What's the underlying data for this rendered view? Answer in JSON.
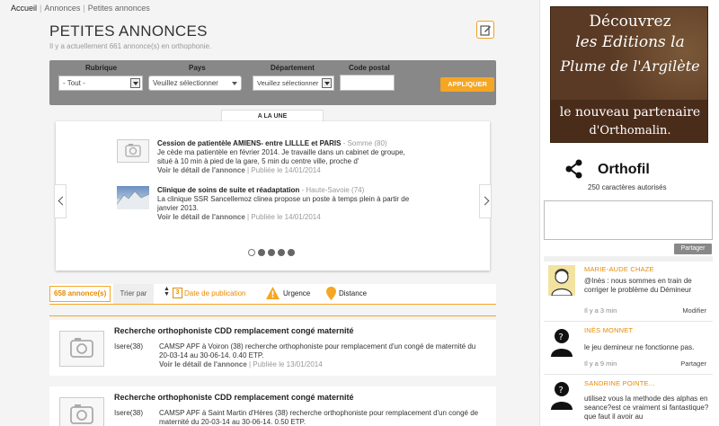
{
  "breadcrumb": {
    "home": "Accueil",
    "items": [
      "Annonces",
      "Petites annonces"
    ]
  },
  "page": {
    "title": "PETITES ANNONCES",
    "subtitle": "Il y a actuellement 661 annonce(s) en orthophonie."
  },
  "filters": {
    "rubrique_label": "Rubrique",
    "rubrique_value": "- Tout -",
    "pays_label": "Pays",
    "pays_value": "Veuillez sélectionner",
    "departement_label": "Département",
    "departement_value": "Veuillez sélectionner",
    "postal_label": "Code postal",
    "postal_value": "",
    "apply_label": "APPLIQUER"
  },
  "featured": {
    "tab_label": "A LA UNE",
    "items": [
      {
        "title": "Cession de patientèle AMIENS- entre LILLLE et PARIS",
        "location": " - Somme (80)",
        "description": "Je cède ma patientèle en février 2014. Je travaille dans un cabinet de groupe, situé à 10 min à pied de la gare, 5 min du centre ville, proche d'",
        "link": "Voir le détail de l'annonce",
        "published": " | Publiée le 14/01/2014"
      },
      {
        "title": "Clinique de soins de suite et réadaptation",
        "location": " - Haute-Savoie (74)",
        "description": "La clinique SSR Sancellemoz clinea propose un poste à temps plein à partir de janvier 2013.",
        "link": "Voir le détail de l'annonce",
        "published": " | Publiée le 14/01/2014"
      }
    ],
    "page_count": 5,
    "active_page": 1
  },
  "sort_bar": {
    "count": "658 annonce(s)",
    "sort_label": "Trier par",
    "date_label": "Date de publication",
    "calendar_digit": "3",
    "urgence_label": "Urgence",
    "distance_label": "Distance"
  },
  "listings": [
    {
      "title": "Recherche orthophoniste CDD remplacement congé maternité",
      "region": "Isere(38)",
      "description": "CAMSP APF à Voiron (38) recherche orthophoniste pour remplacement d'un congé de maternité du 20-03-14 au 30-06-14. 0.40 ETP.",
      "link": "Voir le détail de l'annonce",
      "published": " | Publiée le 13/01/2014"
    },
    {
      "title": "Recherche orthophoniste CDD remplacement congé maternité",
      "region": "Isere(38)",
      "description": "CAMSP APF à Saint Martin d'Hères (38) recherche orthophoniste pour remplacement d'un congé de maternité du 20-03-14 au 30-06-14. 0.50 ETP.",
      "link": "",
      "published": ""
    }
  ],
  "ad": {
    "line1": "Découvrez",
    "line2": "les Editions la",
    "line3": "Plume de l'Argilète",
    "line4": "le nouveau partenaire",
    "line5": "d'Orthomalin."
  },
  "social": {
    "brand": "Orthofil",
    "chars_hint": "250 caractères autorisés",
    "message_value": "",
    "share_label": "Partager"
  },
  "comments": [
    {
      "author": "Marie-aude Chaze",
      "text": "@Inès : nous sommes en train de corriger le problème du Démineur",
      "time": "Il y a 3 min",
      "action": "Modifier"
    },
    {
      "author": "Inès Monnet",
      "text": "le jeu demineur ne fonctionne pas.",
      "time": "Il y a 9 min",
      "action": "Partager"
    },
    {
      "author": "Sandrine Pointe...",
      "text": "utilisez vous la methode des alphas en seance?est ce vraiment si fantastique?que faut il avoir au",
      "time": "",
      "action": ""
    }
  ],
  "colors": {
    "accent": "#f5a623",
    "accent_text": "#e88a00",
    "filter_bar": "#888888"
  }
}
